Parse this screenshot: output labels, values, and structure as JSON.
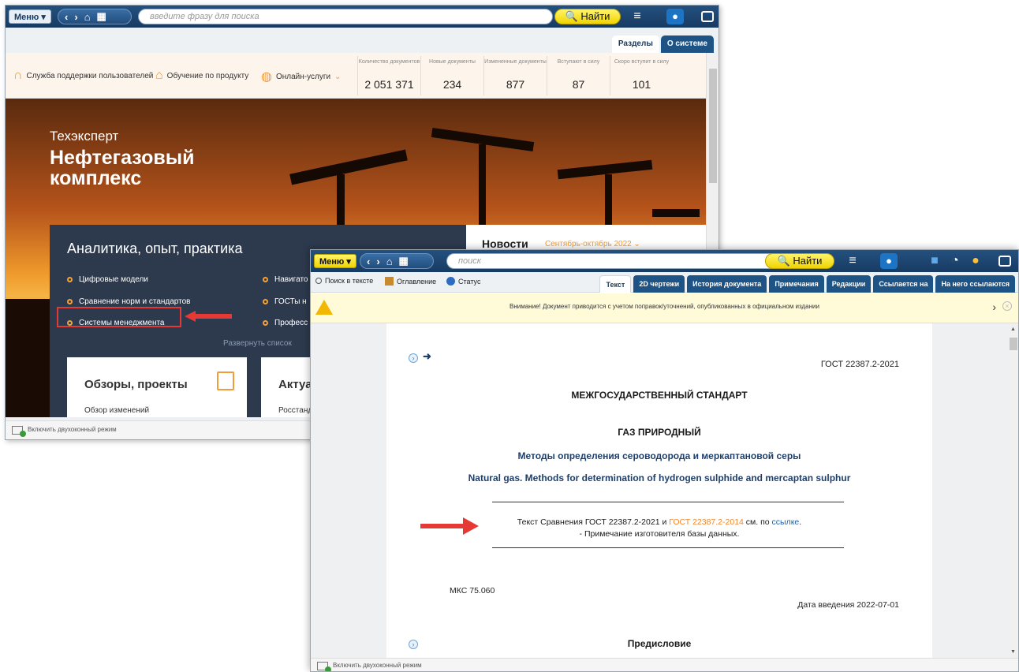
{
  "back_window": {
    "menu_label": "Меню ▾",
    "search_placeholder": "введите фразу для поиска",
    "find_label": "🔍 Найти",
    "tabs": [
      "Разделы",
      "О системе"
    ],
    "support": {
      "service": "Служба поддержки пользователей",
      "training": "Обучение по продукту",
      "online": "Онлайн-услуги"
    },
    "stats": [
      {
        "label": "Количество документов",
        "value": "2 051 371"
      },
      {
        "label": "Новые документы",
        "value": "234"
      },
      {
        "label": "Измененные документы",
        "value": "877"
      },
      {
        "label": "Вступают в силу",
        "value": "87"
      },
      {
        "label": "Скоро вступит в силу",
        "value": "101"
      }
    ],
    "hero": {
      "brand": "Техэксперт",
      "title": "Нефтегазовый комплекс"
    },
    "analytics": {
      "title": "Аналитика, опыт, практика",
      "items_left": [
        "Цифровые модели",
        "Сравнение норм и стандартов",
        "Системы менеджмента"
      ],
      "items_right": [
        "Навигато",
        "ГОСТы н",
        "Професс"
      ],
      "expand": "Развернуть список",
      "cards": [
        {
          "title": "Обзоры, проекты",
          "link": "Обзор изменений"
        },
        {
          "title": "Актуа",
          "link": "Росстанд"
        }
      ]
    },
    "news": {
      "title": "Новости",
      "period": "Сентябрь-октябрь 2022 ⌄"
    },
    "status": "Включить двухоконный режим"
  },
  "front_window": {
    "menu_label": "Меню ▾",
    "search_placeholder": "поиск",
    "find_label": "🔍 Найти",
    "tools": [
      "Поиск в тексте",
      "Оглавление",
      "Статус"
    ],
    "tabs": [
      "Текст",
      "2D чертежи",
      "История документа",
      "Примечания",
      "Редакции",
      "Ссылается на",
      "На него ссылаются"
    ],
    "warning": "Внимание! Документ приводится с учетом поправок/уточнений, опубликованных в официальном издании",
    "doc": {
      "gost_code": "ГОСТ 22387.2-2021",
      "type": "МЕЖГОСУДАРСТВЕННЫЙ СТАНДАРТ",
      "subject": "ГАЗ ПРИРОДНЫЙ",
      "title_ru": "Методы определения сероводорода и меркаптановой серы",
      "title_en": "Natural gas. Methods for determination of hydrogen sulphide and mercaptan sulphur",
      "note_prefix": "Текст Сравнения ГОСТ 22387.2-2021 и ",
      "note_link1": "ГОСТ 22387.2-2014",
      "note_mid": " см. по ",
      "note_link2": "ссылке",
      "note_suffix": ".",
      "note_line2": "- Примечание изготовителя базы данных.",
      "mks": "МКС 75.060",
      "date": "Дата введения 2022-07-01",
      "preface": "Предисловие"
    },
    "status": "Включить двухоконный режим"
  },
  "colors": {
    "accent_orange": "#f29b3b",
    "annotation_red": "#e53935",
    "toolbar_blue": "#1e5385",
    "find_yellow": "#f0d400"
  }
}
